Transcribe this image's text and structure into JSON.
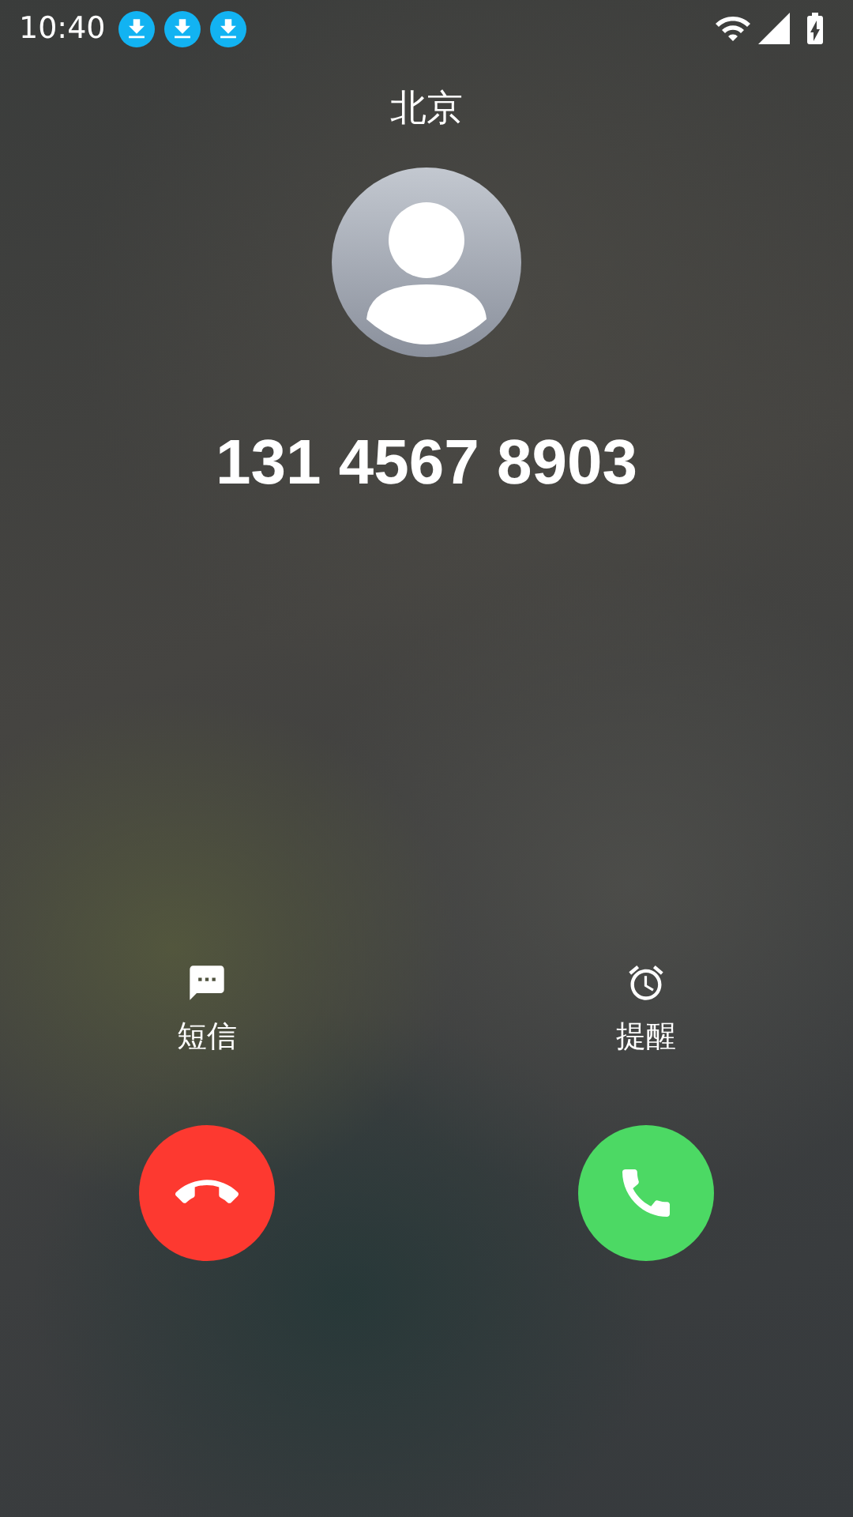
{
  "status_bar": {
    "time": "10:40",
    "notifications": [
      {
        "kind": "download"
      },
      {
        "kind": "download"
      },
      {
        "kind": "download"
      }
    ]
  },
  "call": {
    "location": "北京",
    "number": "131 4567 8903"
  },
  "quick_actions": [
    {
      "kind": "message",
      "label": "短信"
    },
    {
      "kind": "reminder",
      "label": "提醒"
    }
  ],
  "call_buttons": [
    {
      "kind": "decline"
    },
    {
      "kind": "answer"
    }
  ]
}
